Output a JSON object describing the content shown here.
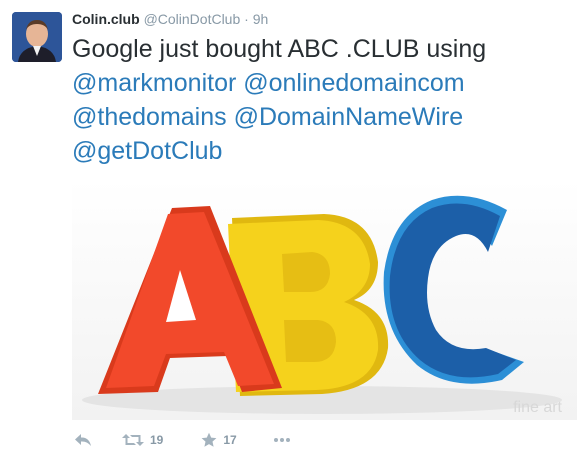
{
  "tweet": {
    "author_name": "Colin.club",
    "handle": "@ColinDotClub",
    "separator": "·",
    "time": "9h",
    "text_plain": "Google just bought ABC .CLUB using",
    "mentions": [
      "@markmonitor",
      "@onlinedomaincom",
      "@thedomains",
      "@DomainNameWire",
      "@getDotClub"
    ]
  },
  "media": {
    "letters": [
      "A",
      "B",
      "C"
    ],
    "watermark": "fine art"
  },
  "actions": {
    "reply_icon": "reply-icon",
    "retweet_icon": "retweet-icon",
    "retweet_count": "19",
    "favorite_icon": "star-icon",
    "favorite_count": "17",
    "more_icon": "more-icon"
  },
  "colors": {
    "link": "#2b7bb9",
    "muted": "#8899a6",
    "text": "#292f33",
    "letter_a": "#f2492b",
    "letter_b": "#f5d21c",
    "letter_c": "#1c5fa8"
  }
}
